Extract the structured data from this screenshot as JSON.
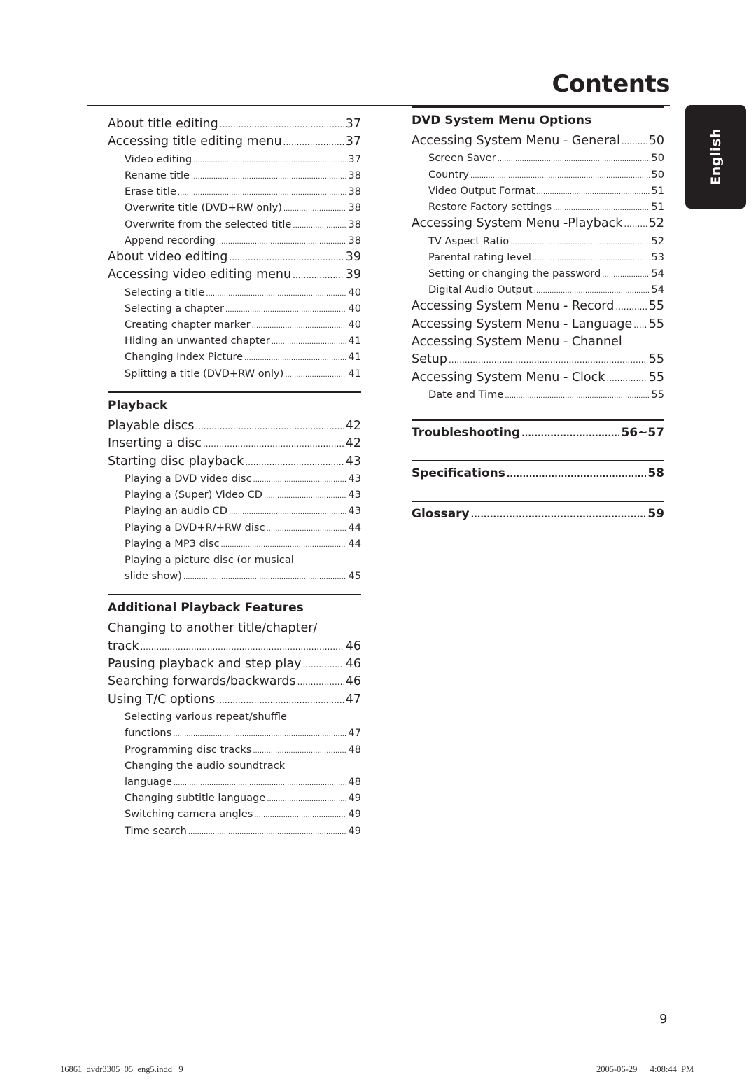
{
  "header": {
    "title": "Contents"
  },
  "side_tab": {
    "label": "English"
  },
  "left_column": {
    "intro_entries": [
      {
        "level": 1,
        "label": "About title editing",
        "page": "37"
      },
      {
        "level": 1,
        "label": "Accessing title editing menu",
        "page": "37"
      },
      {
        "level": 2,
        "label": "Video editing",
        "page": "37"
      },
      {
        "level": 2,
        "label": "Rename title",
        "page": "38"
      },
      {
        "level": 2,
        "label": "Erase title",
        "page": "38"
      },
      {
        "level": 2,
        "label": "Overwrite title (DVD+RW only)",
        "page": "38"
      },
      {
        "level": 2,
        "label": "Overwrite from the selected title",
        "page": "38"
      },
      {
        "level": 2,
        "label": "Append recording",
        "page": "38"
      },
      {
        "level": 1,
        "label": "About video editing",
        "page": "39"
      },
      {
        "level": 1,
        "label": "Accessing video editing menu",
        "page": "39"
      },
      {
        "level": 2,
        "label": "Selecting a title",
        "page": "40"
      },
      {
        "level": 2,
        "label": "Selecting a chapter",
        "page": "40"
      },
      {
        "level": 2,
        "label": "Creating chapter marker",
        "page": "40"
      },
      {
        "level": 2,
        "label": "Hiding an unwanted chapter",
        "page": "41"
      },
      {
        "level": 2,
        "label": "Changing Index Picture",
        "page": "41"
      },
      {
        "level": 2,
        "label": "Splitting a title (DVD+RW only)",
        "page": "41"
      }
    ],
    "playback": {
      "heading": "Playback",
      "entries": [
        {
          "level": 1,
          "label": "Playable discs",
          "page": "42"
        },
        {
          "level": 1,
          "label": "Inserting a disc",
          "page": "42"
        },
        {
          "level": 1,
          "label": "Starting disc playback",
          "page": "43"
        },
        {
          "level": 2,
          "label": "Playing a DVD video disc",
          "page": "43"
        },
        {
          "level": 2,
          "label": "Playing a (Super) Video CD",
          "page": "43"
        },
        {
          "level": 2,
          "label": "Playing an audio CD",
          "page": "43"
        },
        {
          "level": 2,
          "label": "Playing a DVD+R/+RW disc",
          "page": "44"
        },
        {
          "level": 2,
          "label": "Playing a MP3 disc",
          "page": "44"
        },
        {
          "level": 2,
          "label_line1": "Playing a picture disc (or musical",
          "label": "slide show)",
          "page": "45"
        }
      ]
    },
    "additional": {
      "heading": "Additional Playback Features",
      "entries": [
        {
          "level": 1,
          "label_line1": "Changing to another title/chapter/",
          "label": "track",
          "page": "46"
        },
        {
          "level": 1,
          "label": "Pausing playback and step play",
          "page": "46"
        },
        {
          "level": 1,
          "label": "Searching forwards/backwards",
          "page": "46"
        },
        {
          "level": 1,
          "label": "Using T/C options",
          "page": "47"
        },
        {
          "level": 2,
          "label_line1": "Selecting various repeat/shuffle",
          "label": "functions",
          "page": "47"
        },
        {
          "level": 2,
          "label": "Programming disc tracks",
          "page": "48"
        },
        {
          "level": 2,
          "label_line1": "Changing the audio soundtrack",
          "label": "language",
          "page": "48"
        },
        {
          "level": 2,
          "label": "Changing subtitle language",
          "page": "49"
        },
        {
          "level": 2,
          "label": "Switching camera angles",
          "page": "49"
        },
        {
          "level": 2,
          "label": "Time search",
          "page": "49"
        }
      ]
    }
  },
  "right_column": {
    "dvd_system": {
      "heading": "DVD System Menu Options",
      "entries": [
        {
          "level": 1,
          "label": "Accessing System Menu - General",
          "page": "50"
        },
        {
          "level": 2,
          "label": "Screen Saver",
          "page": "50"
        },
        {
          "level": 2,
          "label": "Country",
          "page": "50"
        },
        {
          "level": 2,
          "label": "Video Output Format",
          "page": "51"
        },
        {
          "level": 2,
          "label": "Restore Factory settings",
          "page": "51"
        },
        {
          "level": 1,
          "label": "Accessing System Menu -Playback",
          "page": "52"
        },
        {
          "level": 2,
          "label": "TV Aspect Ratio",
          "page": "52"
        },
        {
          "level": 2,
          "label": "Parental rating level",
          "page": "53"
        },
        {
          "level": 2,
          "label": "Setting or changing the password",
          "page": "54"
        },
        {
          "level": 2,
          "label": "Digital Audio Output",
          "page": "54"
        },
        {
          "level": 1,
          "label": "Accessing System Menu - Record",
          "page": "55"
        },
        {
          "level": 1,
          "label": "Accessing System Menu - Language",
          "page": "55"
        },
        {
          "level": 1,
          "label_line1": "Accessing System Menu - Channel",
          "label": "Setup",
          "page": "55"
        },
        {
          "level": 1,
          "label": "Accessing System Menu - Clock",
          "page": "55"
        },
        {
          "level": 2,
          "label": "Date and Time",
          "page": "55"
        }
      ]
    },
    "bold_sections": [
      {
        "label": "Troubleshooting",
        "page": "56~57"
      },
      {
        "label": "Specifications",
        "page": "58"
      },
      {
        "label": "Glossary",
        "page": "59"
      }
    ]
  },
  "footer": {
    "page_number": "9",
    "slug_file": "16861_dvdr3305_05_eng5.indd   9",
    "slug_timestamp": "2005-06-29   4:08:44 PM"
  }
}
